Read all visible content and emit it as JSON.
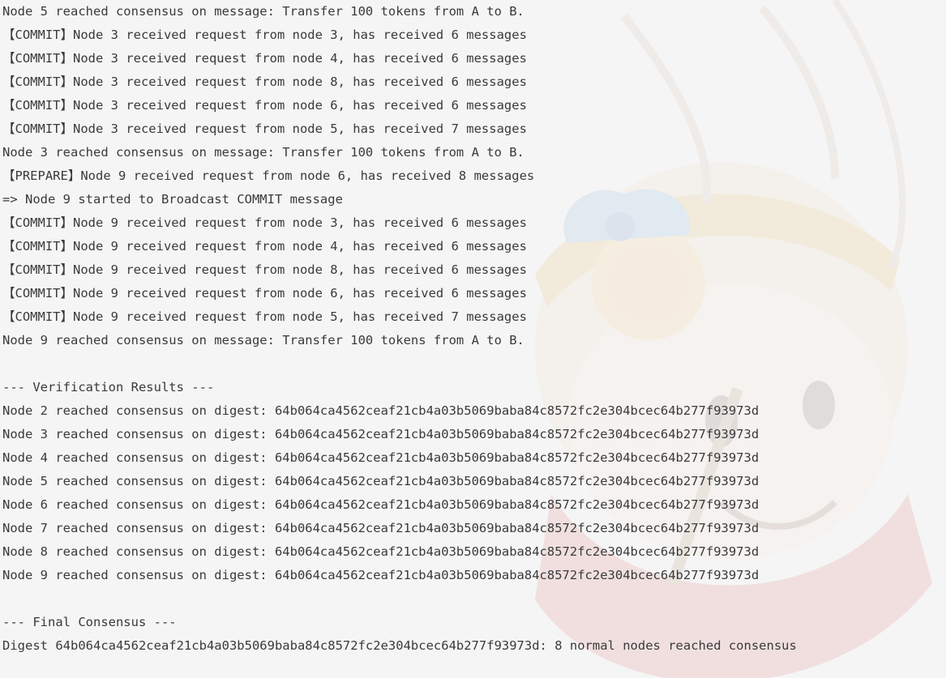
{
  "terminal": {
    "lines": [
      "Node 5 reached consensus on message: Transfer 100 tokens from A to B.",
      "【COMMIT】Node 3 received request from node 3, has received 6 messages",
      "【COMMIT】Node 3 received request from node 4, has received 6 messages",
      "【COMMIT】Node 3 received request from node 8, has received 6 messages",
      "【COMMIT】Node 3 received request from node 6, has received 6 messages",
      "【COMMIT】Node 3 received request from node 5, has received 7 messages",
      "Node 3 reached consensus on message: Transfer 100 tokens from A to B.",
      "【PREPARE】Node 9 received request from node 6, has received 8 messages",
      "=> Node 9 started to Broadcast COMMIT message",
      "【COMMIT】Node 9 received request from node 3, has received 6 messages",
      "【COMMIT】Node 9 received request from node 4, has received 6 messages",
      "【COMMIT】Node 9 received request from node 8, has received 6 messages",
      "【COMMIT】Node 9 received request from node 6, has received 6 messages",
      "【COMMIT】Node 9 received request from node 5, has received 7 messages",
      "Node 9 reached consensus on message: Transfer 100 tokens from A to B.",
      "",
      "--- Verification Results ---",
      "Node 2 reached consensus on digest: 64b064ca4562ceaf21cb4a03b5069baba84c8572fc2e304bcec64b277f93973d",
      "Node 3 reached consensus on digest: 64b064ca4562ceaf21cb4a03b5069baba84c8572fc2e304bcec64b277f93973d",
      "Node 4 reached consensus on digest: 64b064ca4562ceaf21cb4a03b5069baba84c8572fc2e304bcec64b277f93973d",
      "Node 5 reached consensus on digest: 64b064ca4562ceaf21cb4a03b5069baba84c8572fc2e304bcec64b277f93973d",
      "Node 6 reached consensus on digest: 64b064ca4562ceaf21cb4a03b5069baba84c8572fc2e304bcec64b277f93973d",
      "Node 7 reached consensus on digest: 64b064ca4562ceaf21cb4a03b5069baba84c8572fc2e304bcec64b277f93973d",
      "Node 8 reached consensus on digest: 64b064ca4562ceaf21cb4a03b5069baba84c8572fc2e304bcec64b277f93973d",
      "Node 9 reached consensus on digest: 64b064ca4562ceaf21cb4a03b5069baba84c8572fc2e304bcec64b277f93973d",
      "",
      "--- Final Consensus ---",
      "Digest 64b064ca4562ceaf21cb4a03b5069baba84c8572fc2e304bcec64b277f93973d: 8 normal nodes reached consensus"
    ]
  },
  "colors": {
    "background": "#f5f5f5",
    "text": "#3a3a3a"
  }
}
